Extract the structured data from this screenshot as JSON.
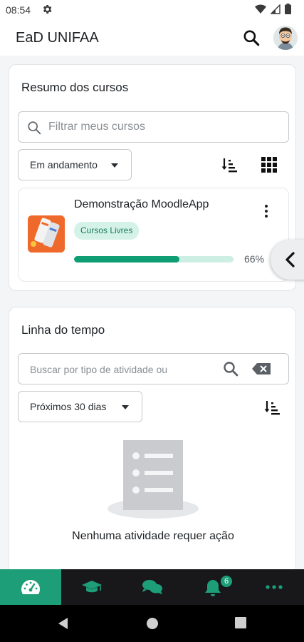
{
  "status_bar": {
    "time": "08:54",
    "icons": [
      "settings-icon",
      "wifi-icon",
      "signal-icon",
      "battery-icon"
    ]
  },
  "header": {
    "title": "EaD UNIFAA",
    "icons": [
      "search-icon",
      "avatar"
    ]
  },
  "course_overview": {
    "title": "Resumo dos cursos",
    "filter_placeholder": "Filtrar meus cursos",
    "status_filter": "Em andamento",
    "courses": [
      {
        "name": "Demonstração MoodleApp",
        "category": "Cursos Livres",
        "progress_percent": 66,
        "progress_label": "66%"
      }
    ]
  },
  "timeline": {
    "title": "Linha do tempo",
    "search_placeholder": "Buscar por tipo de atividade ou",
    "range_filter": "Próximos 30 dias",
    "empty_message": "Nenhuma atividade requer ação"
  },
  "bottom_nav": {
    "items": [
      {
        "icon": "dashboard-icon",
        "active": true
      },
      {
        "icon": "courses-icon",
        "active": false
      },
      {
        "icon": "messages-icon",
        "active": false
      },
      {
        "icon": "notifications-icon",
        "active": false,
        "badge": "6"
      },
      {
        "icon": "more-icon",
        "active": false
      }
    ]
  },
  "colors": {
    "accent": "#1d9e78",
    "progress": "#0f9e74",
    "badge_bg": "#d4f2e8",
    "nav_bg": "#18181b"
  }
}
